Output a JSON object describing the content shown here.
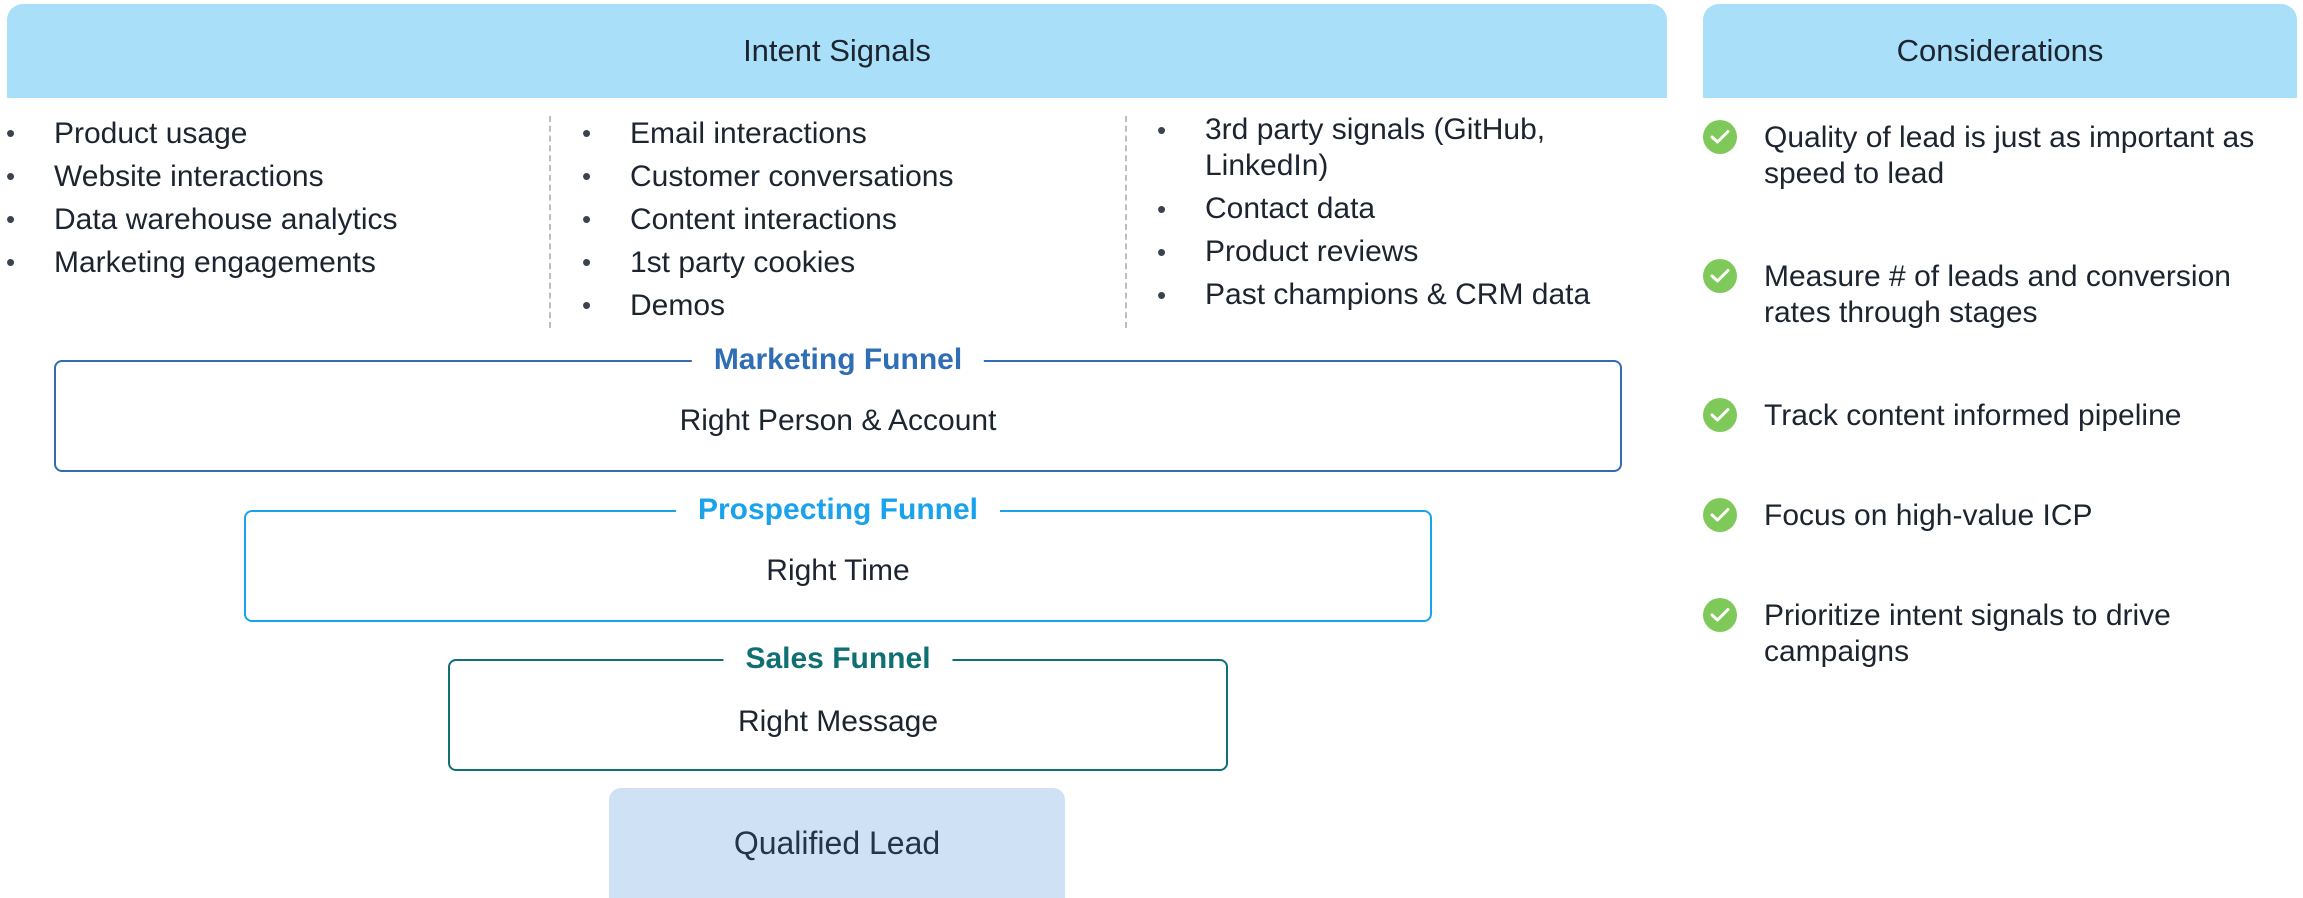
{
  "intent_signals": {
    "header": "Intent Signals",
    "columns": [
      [
        "Product usage",
        "Website interactions",
        "Data warehouse analytics",
        "Marketing engagements"
      ],
      [
        "Email interactions",
        "Customer conversations",
        "Content interactions",
        "1st party cookies",
        "Demos"
      ],
      [
        "3rd party signals (GitHub, LinkedIn)",
        "Contact data",
        "Product reviews",
        "Past champions & CRM data"
      ]
    ]
  },
  "funnels": [
    {
      "title": "Marketing Funnel",
      "subtitle": "Right Person & Account",
      "color": "#2f6eb5"
    },
    {
      "title": "Prospecting Funnel",
      "subtitle": "Right Time",
      "color": "#1aa3ec"
    },
    {
      "title": "Sales Funnel",
      "subtitle": "Right Message",
      "color": "#0f6f73"
    }
  ],
  "qualified_lead": "Qualified Lead",
  "considerations": {
    "header": "Considerations",
    "icon": "check-circle-icon",
    "items": [
      "Quality of lead is just as important as speed to lead",
      "Measure # of leads and conversion rates through stages",
      "Track content informed pipeline",
      "Focus on high-value ICP",
      "Prioritize intent signals to drive campaigns"
    ]
  },
  "colors": {
    "header_bg": "#a9dff8",
    "qualified_lead_bg": "#cfe2f5",
    "check": "#7ec95a"
  }
}
